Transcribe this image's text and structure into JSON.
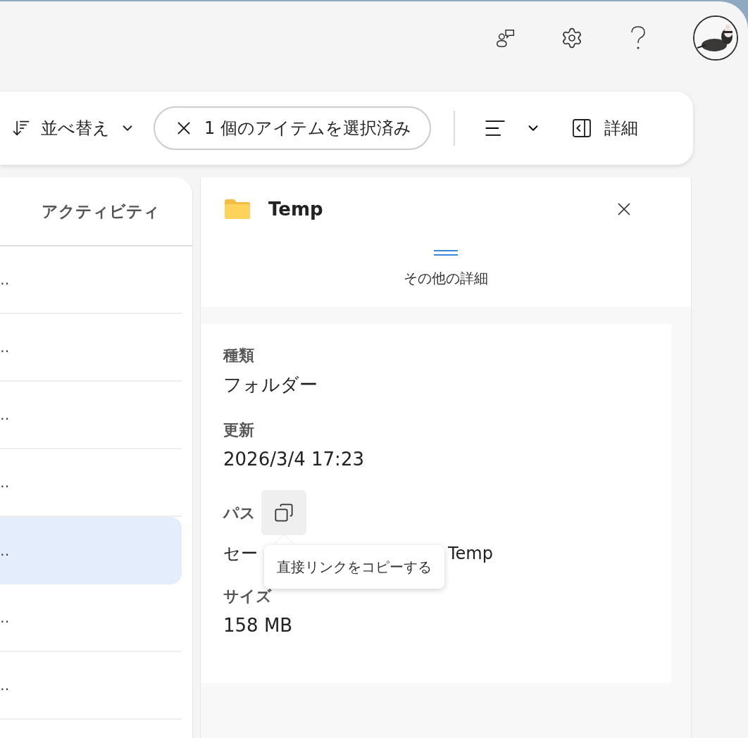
{
  "header": {
    "icons": [
      {
        "kind": "people-chat"
      },
      {
        "kind": "settings"
      },
      {
        "kind": "help"
      },
      {
        "kind": "avatar"
      }
    ]
  },
  "toolbar": {
    "sort": {
      "label": "並べ替え"
    },
    "selection": {
      "label": "1 個のアイテムを選択済み"
    },
    "details": {
      "label": "詳細"
    }
  },
  "list": {
    "column_header": "アクティビティ",
    "rows": [
      {
        "text": "‥",
        "selected": false
      },
      {
        "text": "‥",
        "selected": false
      },
      {
        "text": "‥",
        "selected": false
      },
      {
        "text": "‥",
        "selected": false
      },
      {
        "text": "‥",
        "selected": true
      },
      {
        "text": "‥",
        "selected": false
      },
      {
        "text": "‥",
        "selected": false
      }
    ]
  },
  "details_pane": {
    "title": "Temp",
    "more_details": "その他の詳細",
    "properties": [
      {
        "kind": "text",
        "label": "種類",
        "value": "フォルダー"
      },
      {
        "kind": "text",
        "label": "更新",
        "value": "2026/3/4 17:23"
      },
      {
        "kind": "path",
        "label": "パス",
        "value_start": "セー",
        "value_end": "Temp",
        "tooltip": "直接リンクをコピーする"
      },
      {
        "kind": "text",
        "label": "サイズ",
        "value": "158 MB"
      }
    ]
  }
}
